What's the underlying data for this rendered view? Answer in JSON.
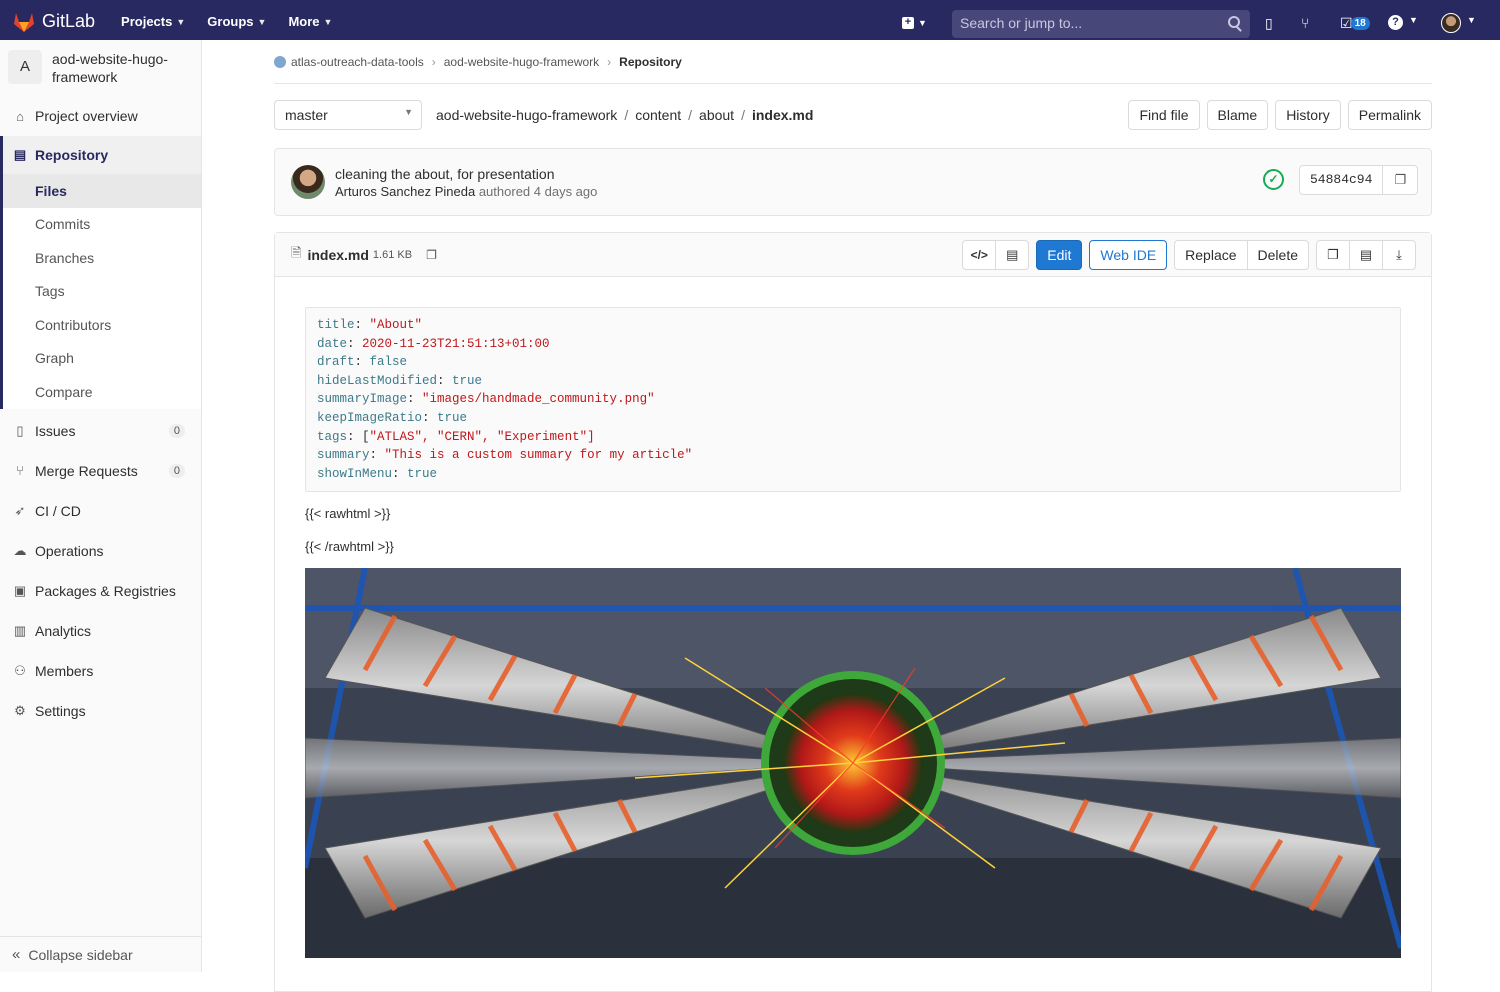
{
  "topbar": {
    "brand": "GitLab",
    "nav": [
      "Projects",
      "Groups",
      "More"
    ],
    "search_placeholder": "Search or jump to...",
    "todo_count": "18"
  },
  "sidebar": {
    "project_initial": "A",
    "project_name": "aod-website-hugo-framework",
    "overview": "Project overview",
    "repository": "Repository",
    "repo_items": [
      "Files",
      "Commits",
      "Branches",
      "Tags",
      "Contributors",
      "Graph",
      "Compare"
    ],
    "issues": "Issues",
    "issues_count": "0",
    "merge_requests": "Merge Requests",
    "mr_count": "0",
    "cicd": "CI / CD",
    "operations": "Operations",
    "packages": "Packages & Registries",
    "analytics": "Analytics",
    "members": "Members",
    "settings": "Settings",
    "collapse": "Collapse sidebar"
  },
  "breadcrumb": [
    "atlas-outreach-data-tools",
    "aod-website-hugo-framework",
    "Repository"
  ],
  "branch": "master",
  "path": [
    "aod-website-hugo-framework",
    "content",
    "about",
    "index.md"
  ],
  "file_buttons": [
    "Find file",
    "Blame",
    "History",
    "Permalink"
  ],
  "commit": {
    "message": "cleaning the about, for presentation",
    "author": "Arturos Sanchez Pineda",
    "when": "authored 4 days ago",
    "sha": "54884c94"
  },
  "blob": {
    "filename": "index.md",
    "size": "1.61 KB",
    "edit": "Edit",
    "web_ide": "Web IDE",
    "replace": "Replace",
    "delete": "Delete"
  },
  "front_matter": [
    {
      "key": "title",
      "sep": ": ",
      "val": "\"About\"",
      "type": "s"
    },
    {
      "key": "date",
      "sep": ": ",
      "val": "2020-11-23T21:51:13+01:00",
      "type": "s"
    },
    {
      "key": "draft",
      "sep": ": ",
      "val": "false",
      "type": "v"
    },
    {
      "key": "hideLastModified",
      "sep": ": ",
      "val": "true",
      "type": "v"
    },
    {
      "key": "summaryImage",
      "sep": ": ",
      "val": "\"images/handmade_community.png\"",
      "type": "s"
    },
    {
      "key": "keepImageRatio",
      "sep": ": ",
      "val": "true",
      "type": "v"
    },
    {
      "key": "tags",
      "sep": ": [",
      "val": "\"ATLAS\", \"CERN\", \"Experiment\"]",
      "type": "s"
    },
    {
      "key": "summary",
      "sep": ": ",
      "val": "\"This is a custom summary for my article\"",
      "type": "s"
    },
    {
      "key": "showInMenu",
      "sep": ": ",
      "val": "true",
      "type": "v"
    }
  ],
  "paragraphs": [
    "{{< rawhtml >}}",
    "{{< /rawhtml >}}"
  ]
}
